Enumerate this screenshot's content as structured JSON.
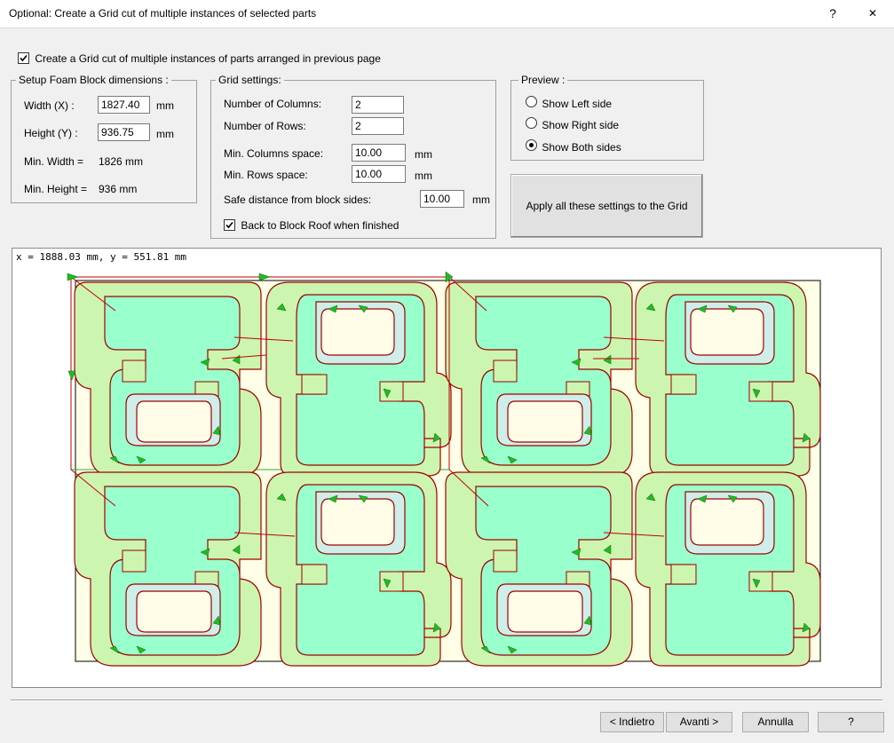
{
  "window": {
    "title": "Optional: Create a Grid cut of multiple instances of selected parts",
    "help": "?",
    "close": "✕"
  },
  "main_check": {
    "label": "Create a Grid cut of multiple instances of parts arranged in previous page",
    "checked": true
  },
  "foam": {
    "legend": "Setup Foam Block dimensions :",
    "width_label": "Width (X) :",
    "width_value": "1827.40",
    "width_unit": "mm",
    "height_label": "Height (Y) :",
    "height_value": "936.75",
    "height_unit": "mm",
    "min_width_label": "Min. Width =",
    "min_width_value": "1826 mm",
    "min_height_label": "Min. Height =",
    "min_height_value": "936 mm"
  },
  "grid": {
    "legend": "Grid settings:",
    "columns_label": "Number of Columns:",
    "columns_value": "2",
    "rows_label": "Number of Rows:",
    "rows_value": "2",
    "min_col_space_label": "Min. Columns space:",
    "min_col_space_value": "10.00",
    "min_col_space_unit": "mm",
    "min_row_space_label": "Min. Rows space:",
    "min_row_space_value": "10.00",
    "min_row_space_unit": "mm",
    "safe_distance_label": "Safe distance from block sides:",
    "safe_distance_value": "10.00",
    "safe_distance_unit": "mm",
    "back_roof_label": "Back to Block Roof when finished",
    "back_roof_checked": true
  },
  "preview": {
    "legend": "Preview :",
    "options": [
      "Show Left side",
      "Show Right side",
      "Show Both sides"
    ],
    "selected": "Show Both sides"
  },
  "apply_button": "Apply all these settings to the Grid",
  "canvas": {
    "coords": "x = 1888.03 mm, y = 551.81 mm"
  },
  "footer": {
    "back": "< Indietro",
    "next": "Avanti >",
    "cancel": "Annulla",
    "help": "?"
  },
  "colors": {
    "part_outer": "#ccf5b0",
    "part_inner": "#99ffcc",
    "hole": "#fffde8",
    "cut_line": "#a00000",
    "arrow": "#22bb22",
    "block": "#fffee6"
  }
}
